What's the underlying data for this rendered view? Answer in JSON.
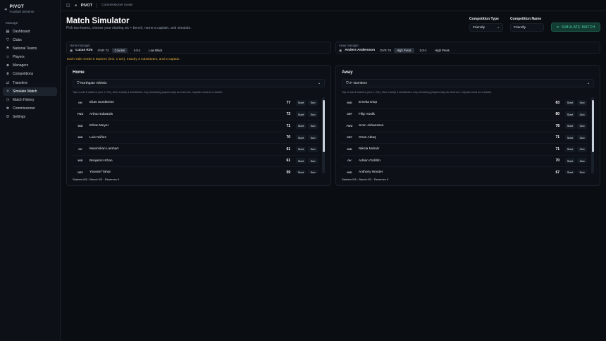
{
  "brand": {
    "name": "PIVOT",
    "subtitle": "Football Universe"
  },
  "sidebar": {
    "section": "Manage",
    "items": [
      {
        "label": "Dashboard",
        "icon": "dashboard-icon",
        "glyph": "▦"
      },
      {
        "label": "Clubs",
        "icon": "shield-icon",
        "glyph": "⛉"
      },
      {
        "label": "National Teams",
        "icon": "flag-icon",
        "glyph": "⚑"
      },
      {
        "label": "Players",
        "icon": "user-icon",
        "glyph": "☺"
      },
      {
        "label": "Managers",
        "icon": "users-icon",
        "glyph": "☻"
      },
      {
        "label": "Competitions",
        "icon": "trophy-icon",
        "glyph": "♛"
      },
      {
        "label": "Transfers",
        "icon": "transfer-icon",
        "glyph": "⇄"
      },
      {
        "label": "Simulate Match",
        "icon": "swords-icon",
        "glyph": "✕",
        "active": true
      },
      {
        "label": "Match History",
        "icon": "history-icon",
        "glyph": "◷"
      },
      {
        "label": "Commissioner",
        "icon": "crown-icon",
        "glyph": "♚"
      },
      {
        "label": "Settings",
        "icon": "gear-icon",
        "glyph": "⚙"
      }
    ]
  },
  "topbar": {
    "brand": "PIVOT",
    "crumb": "Commissioner mode"
  },
  "page": {
    "title": "Match Simulator",
    "subtitle": "Pick two teams, choose your starting six + bench, name a captain, and simulate."
  },
  "controls": {
    "competition_type_label": "Competition Type",
    "competition_type_value": "Friendly",
    "competition_name_label": "Competition Name",
    "competition_name_value": "Friendly",
    "simulate_label": "SIMULATE MATCH"
  },
  "home_manager": {
    "label": "Home manager",
    "name": "Lucas Kim",
    "ovr": "OVR 72",
    "tactics": [
      {
        "label": "Counter",
        "selected": true
      },
      {
        "label": "1-3-1",
        "selected": false
      },
      {
        "label": "Low Block",
        "selected": false
      }
    ]
  },
  "away_manager": {
    "label": "Away manager",
    "name": "Anders Andersson",
    "ovr": "OVR 79",
    "tactics": [
      {
        "label": "High Press",
        "selected": true
      },
      {
        "label": "2-2-1",
        "selected": false
      },
      {
        "label": "High Press",
        "selected": false
      }
    ]
  },
  "warning": "Each side needs 6 starters (incl. 1 GK), exactly 3 substitutes, and a captain.",
  "hint": "Tap to add 6 starters (incl. 1 GK), then exactly 3 substitutes. Any remaining players stay as reserves. Captain must be a starter.",
  "start_label": "Start",
  "sub_label": "Sub",
  "home": {
    "title": "Home",
    "club": "Northgate Athletic",
    "footer": "Starters 0/6 · Bench 0/3 · Reserves 9",
    "players": [
      {
        "pos": "GK",
        "name": "Elias Sundström",
        "ovr": "77"
      },
      {
        "pos": "FWD",
        "name": "Arthur Edwards",
        "ovr": "73"
      },
      {
        "pos": "MID",
        "name": "Ethan Meyer",
        "ovr": "71"
      },
      {
        "pos": "MID",
        "name": "Luis Núñez",
        "ovr": "70"
      },
      {
        "pos": "GK",
        "name": "Maximilian Lienhart",
        "ovr": "61"
      },
      {
        "pos": "MID",
        "name": "Benjamin Khan",
        "ovr": "61"
      },
      {
        "pos": "DEF",
        "name": "Youssef Tahar",
        "ovr": "59"
      }
    ]
  },
  "away": {
    "title": "Away",
    "club": "IF Norrsken",
    "footer": "Starters 0/6 · Bench 0/3 · Reserves 9",
    "players": [
      {
        "pos": "MID",
        "name": "Emeka Diop",
        "ovr": "83"
      },
      {
        "pos": "DEF",
        "name": "Filip Horák",
        "ovr": "80"
      },
      {
        "pos": "FWD",
        "name": "Sven Johansson",
        "ovr": "78"
      },
      {
        "pos": "DEF",
        "name": "Ozan Aktaş",
        "ovr": "71"
      },
      {
        "pos": "MID",
        "name": "Nikola Molnár",
        "ovr": "71"
      },
      {
        "pos": "GK",
        "name": "Adrian Gcilitšo",
        "ovr": "70"
      },
      {
        "pos": "MID",
        "name": "Anthony Wouter",
        "ovr": "67"
      }
    ]
  }
}
